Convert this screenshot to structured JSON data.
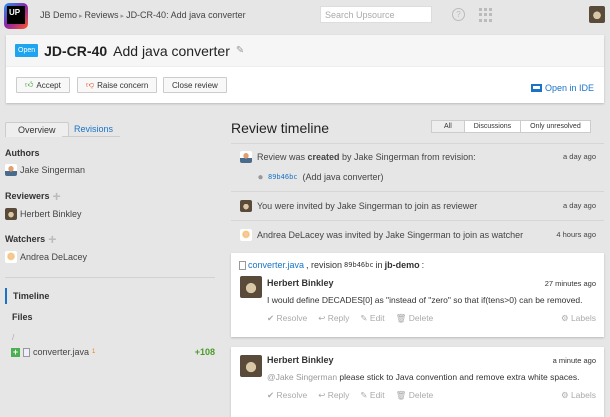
{
  "header": {
    "logo": "UP",
    "breadcrumbs": [
      "JB Demo",
      "Reviews",
      "JD-CR-40: Add java converter"
    ],
    "search_placeholder": "Search Upsource",
    "help": "?"
  },
  "review": {
    "status": "Open",
    "id": "JD-CR-40",
    "title": "Add java converter",
    "actions": {
      "accept": "Accept",
      "raise": "Raise concern",
      "close": "Close review"
    },
    "open_in_ide": "Open in IDE"
  },
  "sidebar": {
    "tabs": [
      "Overview",
      "Revisions"
    ],
    "authors_label": "Authors",
    "authors": [
      "Jake Singerman"
    ],
    "reviewers_label": "Reviewers",
    "reviewers": [
      "Herbert Binkley"
    ],
    "watchers_label": "Watchers",
    "watchers": [
      "Andrea DeLacey"
    ],
    "nav": [
      "Timeline",
      "Files"
    ],
    "dir": "/",
    "file": {
      "name": "converter.java",
      "badge": "1",
      "added": "+108"
    }
  },
  "timeline": {
    "title": "Review timeline",
    "filters": [
      "All",
      "Discussions",
      "Only unresolved"
    ],
    "events": [
      {
        "pre": "Review was ",
        "bold": "created",
        "post": " by Jake Singerman from revision:",
        "time": "a day ago",
        "rev": "89b46bc",
        "rev_msg": "(Add java converter)"
      },
      {
        "text": "You were invited by Jake Singerman to join as reviewer",
        "time": "a day ago"
      },
      {
        "text": "Andrea DeLacey was invited by Jake Singerman to join as watcher",
        "time": "4 hours ago"
      }
    ],
    "discussion": {
      "file": "converter.java",
      "rev_label": ", revision ",
      "rev": "89b46bc",
      "in": " in ",
      "project": "jb-demo",
      "colon": ":"
    },
    "comments": [
      {
        "author": "Herbert Binkley",
        "time": "27 minutes ago",
        "mention": "",
        "text": "I would define DECADES[0] as \"instead of \"zero\" so that if(tens>0) can be removed."
      },
      {
        "author": "Herbert Binkley",
        "time": "a minute ago",
        "mention": "@Jake Singerman",
        "text": " please stick to Java convention and remove extra white spaces."
      }
    ],
    "actions": [
      "Resolve",
      "Reply",
      "Edit",
      "Delete"
    ],
    "labels": "Labels"
  }
}
